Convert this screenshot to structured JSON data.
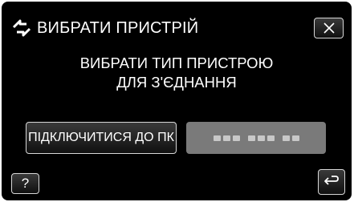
{
  "header": {
    "title": "ВИБРАТИ ПРИСТРІЙ",
    "title_icon": "connection-arrows-icon",
    "close_icon": "close-icon"
  },
  "message": {
    "line1": "ВИБРАТИ ТИП ПРИСТРОЮ",
    "line2": "ДЛЯ З'ЄДНАННЯ"
  },
  "options": {
    "pc_label": "ПІДКЛЮЧИТИСЯ ДО ПК",
    "device_label_icon": "placeholder-label"
  },
  "footer": {
    "help_label": "?",
    "back_icon": "return-arrow-icon"
  },
  "colors": {
    "screen_background": "#000000",
    "text": "#ffffff",
    "button_border": "#d8d8d8",
    "disabled_button": "#7a7a7a"
  }
}
